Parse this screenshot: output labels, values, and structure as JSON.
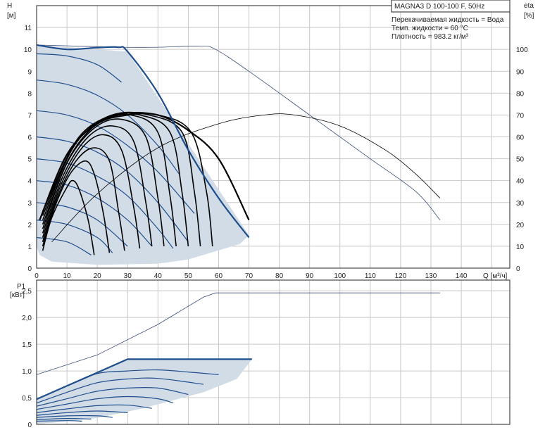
{
  "chart_data": [
    {
      "type": "line",
      "name": "head-efficiency",
      "title": "MAGNA3 D 100-100 F, 50Hz",
      "conditions": [
        "Перекачиваемая жидкость = Вода",
        "Темп. жидкости = 60 °C",
        "Плотность = 983.2 кг/м³"
      ],
      "xlabel": "Q [м³/ч]",
      "ylabel_left": "H",
      "ylabel_left_unit": "[м]",
      "ylabel_right": "eta",
      "ylabel_right_unit": "[%]",
      "xlim": [
        0,
        156
      ],
      "ylim_left": [
        0,
        12
      ],
      "ylim_right": [
        0,
        120
      ],
      "x_ticks": [
        "0",
        "10",
        "20",
        "30",
        "40",
        "50",
        "60",
        "70",
        "80",
        "90",
        "100",
        "110",
        "120",
        "130",
        "140"
      ],
      "y_left_ticks": [
        "0",
        "1",
        "2",
        "3",
        "4",
        "5",
        "6",
        "7",
        "8",
        "9",
        "10",
        "11"
      ],
      "y_right_ticks": [
        "0",
        "10",
        "20",
        "30",
        "40",
        "50",
        "60",
        "70",
        "80",
        "90",
        "100"
      ],
      "grid": true,
      "colors": {
        "region": "#d2dce7",
        "curve": "#1f4e8c",
        "max_curve": "#1f4e8c",
        "thin": "#3a4f7a",
        "eta": "#000000"
      },
      "operating_region": [
        [
          0,
          10.2
        ],
        [
          30,
          9.9
        ],
        [
          70,
          1.5
        ],
        [
          67,
          1.1
        ],
        [
          50,
          0.4
        ],
        [
          40,
          0.2
        ],
        [
          20,
          0.15
        ],
        [
          5,
          0.3
        ],
        [
          1,
          0.6
        ],
        [
          0,
          1.0
        ]
      ],
      "max_curve": [
        [
          0,
          10.2
        ],
        [
          10,
          10.0
        ],
        [
          20,
          10.08
        ],
        [
          27,
          10.1
        ],
        [
          30,
          9.9
        ],
        [
          40,
          8.0
        ],
        [
          50,
          5.4
        ],
        [
          60,
          3.2
        ],
        [
          70,
          1.4
        ]
      ],
      "thin_curve": [
        [
          0,
          10.2
        ],
        [
          27,
          10.1
        ],
        [
          40,
          10.1
        ],
        [
          54,
          10.15
        ],
        [
          59,
          10.0
        ],
        [
          70,
          9.0
        ],
        [
          90,
          7.0
        ],
        [
          110,
          5.0
        ],
        [
          125,
          3.5
        ],
        [
          133,
          2.2
        ]
      ],
      "speed_curves": [
        [
          [
            0,
            9.8
          ],
          [
            10,
            9.7
          ],
          [
            20,
            9.3
          ],
          [
            28,
            8.5
          ]
        ],
        [
          [
            0,
            8.6
          ],
          [
            10,
            8.4
          ],
          [
            20,
            7.9
          ],
          [
            30,
            7.0
          ],
          [
            40,
            5.6
          ],
          [
            47,
            4.3
          ]
        ],
        [
          [
            0,
            7.2
          ],
          [
            10,
            7.0
          ],
          [
            20,
            6.5
          ],
          [
            30,
            5.6
          ],
          [
            40,
            4.4
          ],
          [
            52,
            2.5
          ]
        ],
        [
          [
            0,
            6.0
          ],
          [
            10,
            5.8
          ],
          [
            20,
            5.3
          ],
          [
            30,
            4.4
          ],
          [
            40,
            3.0
          ],
          [
            50,
            1.2
          ]
        ],
        [
          [
            0,
            5.0
          ],
          [
            10,
            4.8
          ],
          [
            20,
            4.2
          ],
          [
            30,
            3.3
          ],
          [
            40,
            1.8
          ],
          [
            45,
            0.9
          ]
        ],
        [
          [
            0,
            4.0
          ],
          [
            10,
            3.8
          ],
          [
            20,
            3.2
          ],
          [
            30,
            2.2
          ],
          [
            38,
            1.0
          ]
        ],
        [
          [
            0,
            3.0
          ],
          [
            10,
            2.8
          ],
          [
            20,
            2.2
          ],
          [
            30,
            1.0
          ]
        ],
        [
          [
            0,
            2.2
          ],
          [
            10,
            2.0
          ],
          [
            20,
            1.4
          ],
          [
            25,
            0.7
          ]
        ],
        [
          [
            0,
            1.4
          ],
          [
            10,
            1.2
          ],
          [
            18,
            0.6
          ]
        ]
      ],
      "efficiency_curves": [
        [
          [
            2,
            0.8
          ],
          [
            5,
            2.3
          ],
          [
            10,
            3.7
          ],
          [
            12,
            4.0
          ],
          [
            14,
            3.6
          ],
          [
            17,
            2.2
          ],
          [
            19,
            0.6
          ]
        ],
        [
          [
            2,
            1.0
          ],
          [
            6,
            2.8
          ],
          [
            11,
            4.3
          ],
          [
            16,
            4.9
          ],
          [
            19,
            4.3
          ],
          [
            22,
            2.5
          ],
          [
            24,
            0.7
          ]
        ],
        [
          [
            2,
            1.2
          ],
          [
            7,
            3.3
          ],
          [
            13,
            4.9
          ],
          [
            19,
            5.5
          ],
          [
            24,
            4.9
          ],
          [
            27,
            2.6
          ],
          [
            29,
            0.8
          ]
        ],
        [
          [
            2,
            1.4
          ],
          [
            8,
            3.8
          ],
          [
            15,
            5.5
          ],
          [
            22,
            6.1
          ],
          [
            28,
            5.4
          ],
          [
            32,
            2.8
          ],
          [
            34,
            0.9
          ]
        ],
        [
          [
            2,
            1.6
          ],
          [
            9,
            4.3
          ],
          [
            17,
            6.0
          ],
          [
            25,
            6.5
          ],
          [
            32,
            5.8
          ],
          [
            36,
            3.0
          ],
          [
            38,
            1.0
          ]
        ],
        [
          [
            2,
            1.8
          ],
          [
            10,
            4.8
          ],
          [
            19,
            6.4
          ],
          [
            28,
            6.8
          ],
          [
            36,
            6.0
          ],
          [
            40,
            3.2
          ],
          [
            42,
            1.0
          ]
        ],
        [
          [
            2,
            2.0
          ],
          [
            11,
            5.1
          ],
          [
            21,
            6.7
          ],
          [
            31,
            7.0
          ],
          [
            40,
            6.2
          ],
          [
            44,
            3.3
          ],
          [
            46,
            1.0
          ]
        ],
        [
          [
            2,
            2.2
          ],
          [
            12,
            5.5
          ],
          [
            23,
            6.9
          ],
          [
            34,
            7.0
          ],
          [
            44,
            6.2
          ],
          [
            48,
            3.4
          ],
          [
            50,
            1.0
          ]
        ],
        [
          [
            2,
            2.4
          ],
          [
            13,
            5.8
          ],
          [
            25,
            7.0
          ],
          [
            37,
            7.0
          ],
          [
            48,
            6.2
          ],
          [
            52,
            3.5
          ],
          [
            54,
            1.0
          ]
        ],
        [
          [
            2,
            2.6
          ],
          [
            14,
            6.0
          ],
          [
            27,
            7.0
          ],
          [
            40,
            7.0
          ],
          [
            51,
            6.2
          ],
          [
            56,
            3.5
          ],
          [
            58,
            1.0
          ]
        ]
      ],
      "max_efficiency_curve": [
        [
          1,
          2.2
        ],
        [
          10,
          5.2
        ],
        [
          20,
          6.6
        ],
        [
          30,
          7.0
        ],
        [
          40,
          7.0
        ],
        [
          50,
          6.3
        ],
        [
          60,
          5.0
        ],
        [
          70,
          2.2
        ]
      ],
      "eta_curve": [
        [
          5,
          1.2
        ],
        [
          20,
          3.4
        ],
        [
          40,
          5.5
        ],
        [
          60,
          6.6
        ],
        [
          75,
          7.0
        ],
        [
          85,
          7.0
        ],
        [
          100,
          6.5
        ],
        [
          115,
          5.4
        ],
        [
          125,
          4.3
        ],
        [
          133,
          3.2
        ]
      ]
    },
    {
      "type": "line",
      "name": "power",
      "xlabel": "",
      "ylabel": "P1",
      "ylabel_unit": "[кВт]",
      "xlim": [
        0,
        156
      ],
      "ylim": [
        0,
        2.7
      ],
      "y_ticks": [
        "0",
        "0,5",
        "1,0",
        "1,5",
        "2,0",
        "2,5"
      ],
      "grid": true,
      "operating_region": [
        [
          0,
          0.47
        ],
        [
          30,
          1.22
        ],
        [
          71,
          1.22
        ],
        [
          66,
          0.85
        ],
        [
          55,
          0.6
        ],
        [
          35,
          0.3
        ],
        [
          20,
          0.12
        ],
        [
          5,
          0.03
        ],
        [
          0,
          0.01
        ]
      ],
      "max_curve": [
        [
          0,
          0.47
        ],
        [
          10,
          0.72
        ],
        [
          20,
          0.97
        ],
        [
          30,
          1.22
        ],
        [
          71,
          1.22
        ]
      ],
      "thin_curve": [
        [
          0,
          0.93
        ],
        [
          20,
          1.3
        ],
        [
          40,
          1.87
        ],
        [
          55,
          2.38
        ],
        [
          59,
          2.46
        ],
        [
          80,
          2.46
        ],
        [
          133,
          2.46
        ]
      ],
      "speed_curves": [
        [
          [
            0,
            0.47
          ],
          [
            10,
            0.72
          ],
          [
            20,
            0.95
          ],
          [
            30,
            1.0
          ],
          [
            40,
            1.02
          ],
          [
            50,
            0.98
          ],
          [
            60,
            0.93
          ]
        ],
        [
          [
            0,
            0.4
          ],
          [
            10,
            0.6
          ],
          [
            20,
            0.78
          ],
          [
            30,
            0.85
          ],
          [
            40,
            0.86
          ],
          [
            55,
            0.75
          ]
        ],
        [
          [
            0,
            0.34
          ],
          [
            10,
            0.48
          ],
          [
            20,
            0.62
          ],
          [
            30,
            0.68
          ],
          [
            40,
            0.68
          ],
          [
            50,
            0.56
          ]
        ],
        [
          [
            0,
            0.28
          ],
          [
            10,
            0.38
          ],
          [
            20,
            0.48
          ],
          [
            30,
            0.52
          ],
          [
            40,
            0.48
          ],
          [
            45,
            0.4
          ]
        ],
        [
          [
            0,
            0.22
          ],
          [
            10,
            0.29
          ],
          [
            20,
            0.35
          ],
          [
            30,
            0.36
          ],
          [
            38,
            0.3
          ]
        ],
        [
          [
            0,
            0.17
          ],
          [
            10,
            0.22
          ],
          [
            20,
            0.25
          ],
          [
            30,
            0.22
          ]
        ],
        [
          [
            0,
            0.13
          ],
          [
            10,
            0.16
          ],
          [
            20,
            0.16
          ],
          [
            25,
            0.13
          ]
        ],
        [
          [
            0,
            0.09
          ],
          [
            10,
            0.11
          ],
          [
            18,
            0.1
          ]
        ],
        [
          [
            0,
            0.06
          ],
          [
            10,
            0.07
          ],
          [
            15,
            0.06
          ]
        ]
      ]
    }
  ]
}
